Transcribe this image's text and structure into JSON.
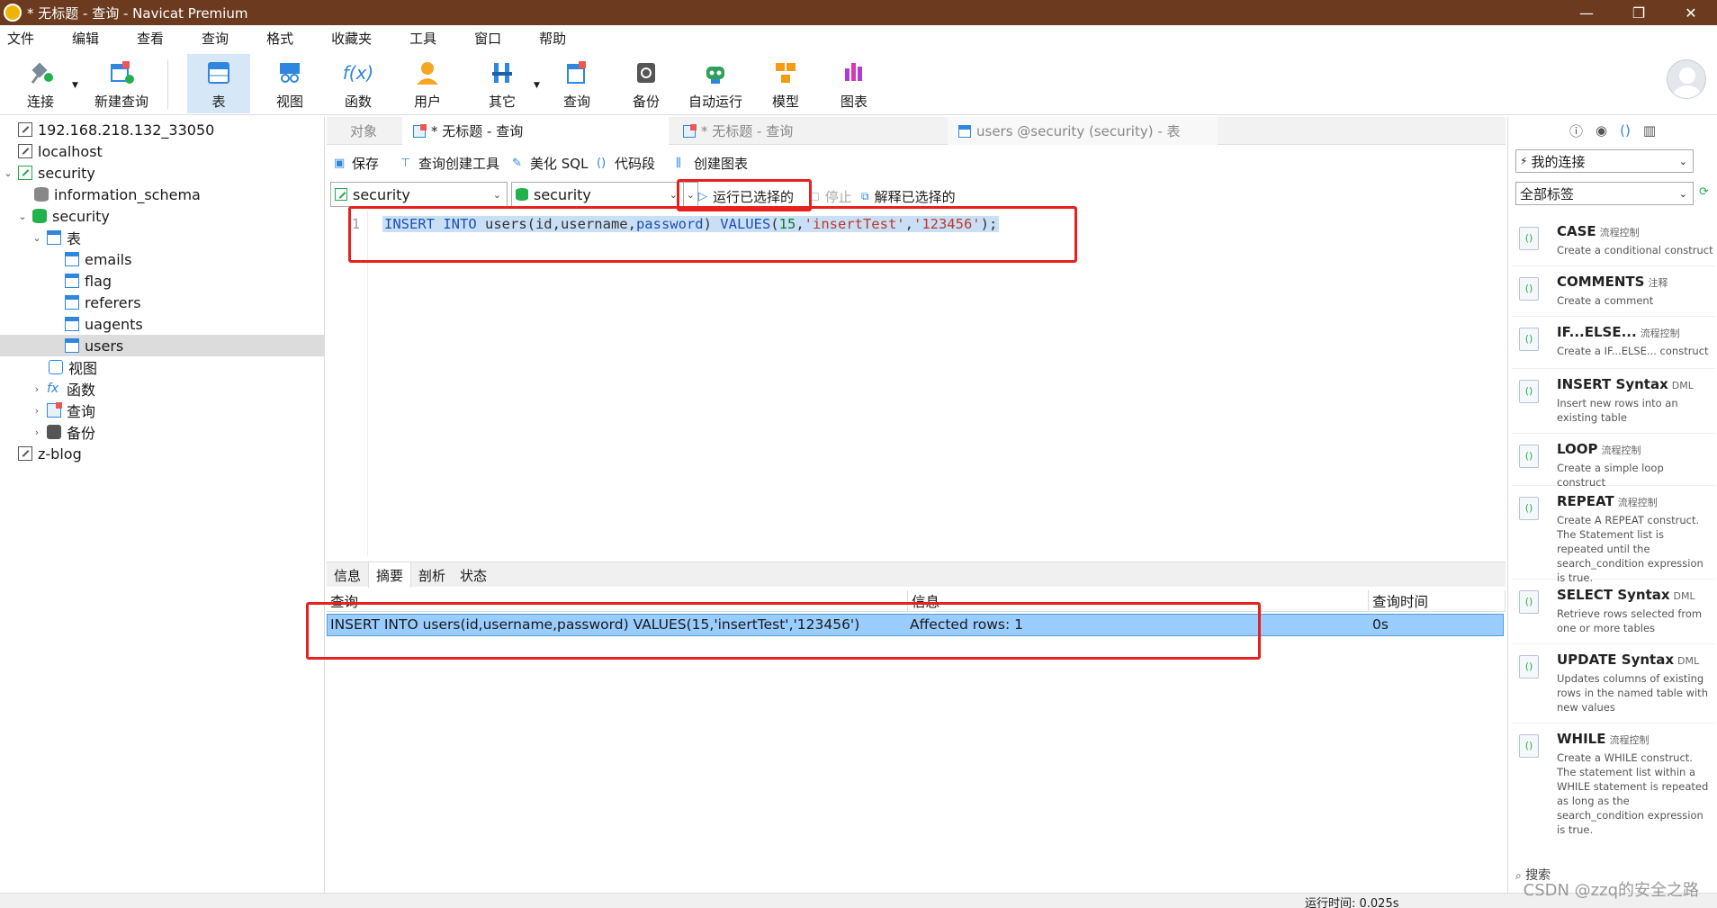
{
  "window": {
    "title": "* 无标题 - 查询 - Navicat Premium",
    "buttons": [
      "—",
      "❐",
      "✕"
    ]
  },
  "menu": [
    "文件",
    "编辑",
    "查看",
    "查询",
    "格式",
    "收藏夹",
    "工具",
    "窗口",
    "帮助"
  ],
  "toolbar": [
    {
      "label": "连接",
      "icon": "plug-icon"
    },
    {
      "label": "新建查询",
      "icon": "new-query-icon"
    },
    {
      "label": "表",
      "icon": "table-icon"
    },
    {
      "label": "视图",
      "icon": "view-icon"
    },
    {
      "label": "函数",
      "icon": "function-icon",
      "glyph": "f(x)"
    },
    {
      "label": "用户",
      "icon": "user-icon"
    },
    {
      "label": "其它",
      "icon": "tools-icon"
    },
    {
      "label": "查询",
      "icon": "query-icon"
    },
    {
      "label": "备份",
      "icon": "backup-icon"
    },
    {
      "label": "自动运行",
      "icon": "robot-icon"
    },
    {
      "label": "模型",
      "icon": "model-icon"
    },
    {
      "label": "图表",
      "icon": "chart-icon"
    }
  ],
  "tree": [
    {
      "label": "192.168.218.132_33050",
      "type": "conn"
    },
    {
      "label": "localhost",
      "type": "conn"
    },
    {
      "label": "security",
      "type": "conn-green",
      "caret": "⌄"
    },
    {
      "label": "information_schema",
      "type": "db"
    },
    {
      "label": "security",
      "type": "db-green",
      "caret": "⌄"
    },
    {
      "label": "表",
      "type": "table",
      "caret": "⌄"
    },
    {
      "label": "emails",
      "type": "table"
    },
    {
      "label": "flag",
      "type": "table"
    },
    {
      "label": "referers",
      "type": "table"
    },
    {
      "label": "uagents",
      "type": "table"
    },
    {
      "label": "users",
      "type": "table",
      "selected": true
    },
    {
      "label": "视图",
      "type": "view"
    },
    {
      "label": "函数",
      "type": "func",
      "caret": "›"
    },
    {
      "label": "查询",
      "type": "query",
      "caret": "›"
    },
    {
      "label": "备份",
      "type": "backup",
      "caret": "›"
    },
    {
      "label": "z-blog",
      "type": "conn"
    }
  ],
  "tabs": [
    {
      "label": "对象"
    },
    {
      "label": "* 无标题 - 查询",
      "active": true
    },
    {
      "label": "* 无标题 - 查询"
    },
    {
      "label": "users @security (security) - 表"
    }
  ],
  "editor_toolbar": {
    "save": "保存",
    "query_builder": "查询创建工具",
    "beautify": "美化 SQL",
    "snippet": "代码段",
    "create_chart": "创建图表",
    "run_selected": "运行已选择的",
    "stop": "停止",
    "explain": "解释已选择的"
  },
  "selectors": {
    "connection": "security",
    "database": "security"
  },
  "editor": {
    "line_number": "1",
    "code": {
      "kw1": "INSERT INTO",
      "tbl": " users(id,username,",
      "col": "password",
      "p1": ") ",
      "kw2": "VALUES",
      "p2": "(",
      "num": "15",
      "p3": ",",
      "s1": "'insertTest'",
      "p4": ",",
      "s2": "'123456'",
      "p5": ");"
    }
  },
  "result_tabs": [
    "信息",
    "摘要",
    "剖析",
    "状态"
  ],
  "result": {
    "headers": {
      "query": "查询",
      "info": "信息",
      "time": "查询时间"
    },
    "row": {
      "query": "INSERT INTO users(id,username,password) VALUES(15,'insertTest','123456')",
      "info": "Affected rows: 1",
      "time": "0s"
    }
  },
  "right_panel": {
    "connection_select": "我的连接",
    "tag_select": "全部标签",
    "search_label": "搜索",
    "snippets": [
      {
        "name": "CASE",
        "tag": "流程控制",
        "desc": "Create a conditional construct"
      },
      {
        "name": "COMMENTS",
        "tag": "注释",
        "desc": "Create a comment"
      },
      {
        "name": "IF...ELSE...",
        "tag": "流程控制",
        "desc": "Create a IF...ELSE... construct"
      },
      {
        "name": "INSERT Syntax",
        "tag": "DML",
        "desc": "Insert new rows into an existing table"
      },
      {
        "name": "LOOP",
        "tag": "流程控制",
        "desc": "Create a simple loop construct"
      },
      {
        "name": "REPEAT",
        "tag": "流程控制",
        "desc": "Create A REPEAT construct. The Statement list is repeated until the search_condition expression is true."
      },
      {
        "name": "SELECT Syntax",
        "tag": "DML",
        "desc": "Retrieve rows selected from one or more tables"
      },
      {
        "name": "UPDATE Syntax",
        "tag": "DML",
        "desc": "Updates columns of existing rows in the named table with new values"
      },
      {
        "name": "WHILE",
        "tag": "流程控制",
        "desc": "Create a WHILE construct. The statement list within a WHILE statement is repeated as long as the search_condition expression is true."
      }
    ]
  },
  "status": {
    "runtime": "运行时间: 0.025s"
  },
  "watermark": "CSDN @zzq的安全之路",
  "colors": {
    "titlebar": "#6b3a1f",
    "accent": "#2e86de",
    "highlight": "#99ccff",
    "redbox": "#e8201e"
  }
}
